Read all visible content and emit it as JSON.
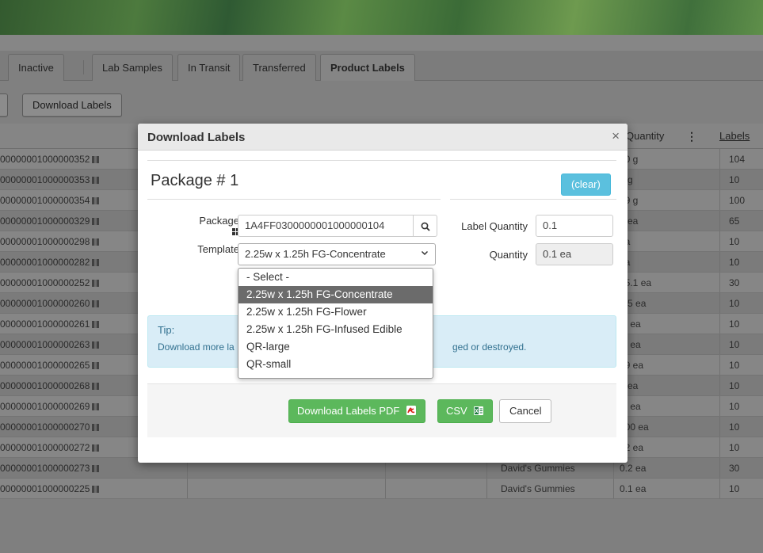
{
  "tabs": [
    {
      "label": "Inactive"
    },
    {
      "label": "Lab Samples"
    },
    {
      "label": "In Transit"
    },
    {
      "label": "Transferred"
    },
    {
      "label": "Product Labels",
      "active": true
    }
  ],
  "toolbar": {
    "download_labels": "Download Labels"
  },
  "grid": {
    "headers": {
      "quantity": "Quantity",
      "labels": "Labels",
      "more": "⋮"
    },
    "rows": [
      {
        "tag": "00000001000000352",
        "item": "",
        "quantity": "00 g",
        "labels": "104"
      },
      {
        "tag": "00000001000000353",
        "item": "",
        "quantity": "0 g",
        "labels": "10"
      },
      {
        "tag": "00000001000000354",
        "item": "",
        "quantity": "99 g",
        "labels": "100"
      },
      {
        "tag": "00000001000000329",
        "item": "",
        "quantity": "0 ea",
        "labels": "65"
      },
      {
        "tag": "00000001000000298",
        "item": "",
        "quantity": "ea",
        "labels": "10"
      },
      {
        "tag": "00000001000000282",
        "item": "",
        "quantity": "ea",
        "labels": "10"
      },
      {
        "tag": "00000001000000252",
        "item": "",
        "quantity": "15.1 ea",
        "labels": "30"
      },
      {
        "tag": "00000001000000260",
        "item": "",
        "quantity": "0.5 ea",
        "labels": "10"
      },
      {
        "tag": "00000001000000261",
        "item": "",
        "quantity": ".1 ea",
        "labels": "10"
      },
      {
        "tag": "00000001000000263",
        "item": "",
        "quantity": ".2 ea",
        "labels": "10"
      },
      {
        "tag": "00000001000000265",
        "item": "",
        "quantity": "69 ea",
        "labels": "10"
      },
      {
        "tag": "00000001000000268",
        "item": "",
        "quantity": "6 ea",
        "labels": "10"
      },
      {
        "tag": "00000001000000269",
        "item": "",
        "quantity": ".1 ea",
        "labels": "10"
      },
      {
        "tag": "00000001000000270",
        "item": "David's Gummies",
        "quantity": "100 ea",
        "labels": "10"
      },
      {
        "tag": "00000001000000272",
        "item": "David's Gummies",
        "quantity": "22 ea",
        "labels": "10"
      },
      {
        "tag": "00000001000000273",
        "item": "David's Gummies",
        "quantity": "0.2 ea",
        "labels": "30"
      },
      {
        "tag": "00000001000000225",
        "item": "David's Gummies",
        "quantity": "0.1 ea",
        "labels": "10"
      }
    ]
  },
  "modal": {
    "title": "Download Labels",
    "close": "×",
    "package_heading": "Package # 1",
    "clear_label": "(clear)",
    "package_label": "Package",
    "package_value": "1A4FF0300000001000000104",
    "template_label": "Template",
    "template_value": "2.25w x 1.25h FG-Concentrate",
    "label_quantity_label": "Label Quantity",
    "label_quantity_value": "0.1",
    "quantity_label": "Quantity",
    "quantity_value": "0.1 ea",
    "tip_title": "Tip:",
    "tip_text_start": "Download more la",
    "tip_text_end": "ged or destroyed.",
    "download_pdf_label": "Download Labels PDF",
    "csv_label": "CSV",
    "cancel_label": "Cancel"
  },
  "template_options": [
    {
      "label": "- Select -"
    },
    {
      "label": "2.25w x 1.25h FG-Concentrate",
      "selected": true
    },
    {
      "label": "2.25w x 1.25h FG-Flower"
    },
    {
      "label": "2.25w x 1.25h FG-Infused Edible"
    },
    {
      "label": "QR-large"
    },
    {
      "label": "QR-small"
    }
  ],
  "colors": {
    "overlay": "#7f7f7f",
    "clear_button": "#5bc0de",
    "primary_green": "#5cb85c",
    "tip_background": "#d9edf7",
    "selected_option": "#6b6b6b"
  }
}
